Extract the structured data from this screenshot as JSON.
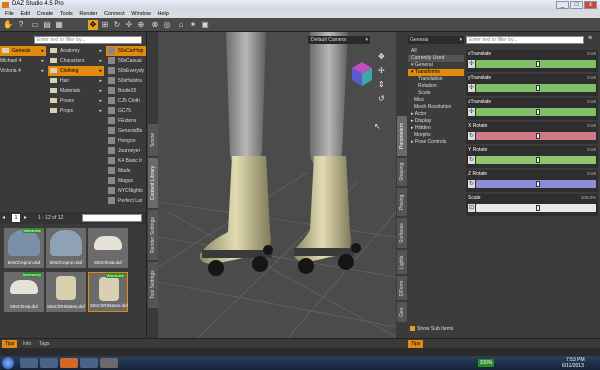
{
  "window": {
    "title": "DAZ Studio 4.5 Pro",
    "min": "_",
    "max": "□",
    "close": "x"
  },
  "menu": [
    "File",
    "Edit",
    "Create",
    "Tools",
    "Render",
    "Connect",
    "Window",
    "Help"
  ],
  "content_library": {
    "search_placeholder": "Enter text to filter by...",
    "col1": [
      {
        "label": "Genesis",
        "selected": true
      },
      {
        "label": "Michael 4",
        "selected": false
      },
      {
        "label": "Victoria 4",
        "selected": false
      }
    ],
    "col2": [
      {
        "label": "Anatomy",
        "selected": false
      },
      {
        "label": "Characters",
        "selected": false
      },
      {
        "label": "Clothing",
        "selected": true
      },
      {
        "label": "Hair",
        "selected": false
      },
      {
        "label": "Materials",
        "selected": false
      },
      {
        "label": "Poses",
        "selected": false
      },
      {
        "label": "Props",
        "selected": false
      }
    ],
    "col3": [
      {
        "label": "50sCarHop",
        "selected": true
      },
      {
        "label": "50sCasual",
        "selected": false
      },
      {
        "label": "50sEverydy",
        "selected": false
      },
      {
        "label": "50sHalstra",
        "selected": false
      },
      {
        "label": "Bodie25",
        "selected": false
      },
      {
        "label": "CJ5 Cloth",
        "selected": false
      },
      {
        "label": "GC75",
        "selected": false
      },
      {
        "label": "FExtens",
        "selected": false
      },
      {
        "label": "GenesisBs",
        "selected": false
      },
      {
        "label": "Hongoo",
        "selected": false
      },
      {
        "label": "Journeyer",
        "selected": false
      },
      {
        "label": "K4 Basic Ir",
        "selected": false
      },
      {
        "label": "Made",
        "selected": false
      },
      {
        "label": "Magus",
        "selected": false
      },
      {
        "label": "NYCNights",
        "selected": false
      },
      {
        "label": "Perfect Lar",
        "selected": false
      }
    ],
    "page_num": "1",
    "page_info": "1 - 12 of 12",
    "thumbs": [
      {
        "label": "50sChApron.duf",
        "badge": "Wardrobe"
      },
      {
        "label": "50sChApron.duf",
        "badge": ""
      },
      {
        "label": "50sChHat.duf",
        "badge": ""
      },
      {
        "label": "50sChHat.duf",
        "badge": "Accessory"
      },
      {
        "label": "50sChRSkates.duf",
        "badge": ""
      },
      {
        "label": "50sChRSkates.duf",
        "badge": "Wardrobe"
      }
    ]
  },
  "left_tabs": [
    "Scene",
    "Content Library",
    "Render Settings",
    "Tool Settings"
  ],
  "viewport": {
    "camera": "Default Camera"
  },
  "right_tabs": [
    "Parameters",
    "Shaping",
    "Posing",
    "Surfaces",
    "Lights",
    "DForm",
    "Geo"
  ],
  "parameters": {
    "node": "Genesis",
    "search_placeholder": "Enter text to filter by...",
    "list": [
      {
        "label": "All",
        "selected": false
      },
      {
        "label": "Currently Used",
        "selected": false
      },
      {
        "label": "▾ General",
        "selected": false
      },
      {
        "label": "▾ Transforms",
        "selected": true
      },
      {
        "label": "Translation",
        "selected": false
      },
      {
        "label": "Rotation",
        "selected": false
      },
      {
        "label": "Scale",
        "selected": false
      },
      {
        "label": "Misc",
        "selected": false
      },
      {
        "label": "Mesh Resolution",
        "selected": false
      },
      {
        "label": "▸ Actor",
        "selected": false
      },
      {
        "label": "▸ Display",
        "selected": false
      },
      {
        "label": "▸ Hidden",
        "selected": false
      },
      {
        "label": "Morphs",
        "selected": false
      },
      {
        "label": "▸ Pose Controls",
        "selected": false
      }
    ],
    "show_sub_items": "Show Sub Items",
    "props": [
      {
        "name": "xTranslate",
        "value": "0.00",
        "color": "#7fbf6a"
      },
      {
        "name": "yTranslate",
        "value": "0.00",
        "color": "#7fbf6a"
      },
      {
        "name": "zTranslate",
        "value": "0.00",
        "color": "#7fbf6a"
      },
      {
        "name": "X Rotate",
        "value": "0.00",
        "color": "#d07a88"
      },
      {
        "name": "Y Rotate",
        "value": "0.00",
        "color": "#8fc66e"
      },
      {
        "name": "Z Rotate",
        "value": "0.00",
        "color": "#8e8ed6"
      },
      {
        "name": "Scale",
        "value": "100.0%",
        "color": "#e9e9e9"
      }
    ]
  },
  "bottom_tabs": {
    "left": [
      "Tips",
      "Info",
      "Tags"
    ],
    "right": [
      "Tips"
    ]
  },
  "tray": {
    "zoom": "100%",
    "time": "7:53 PM",
    "date": "6/11/2013"
  }
}
